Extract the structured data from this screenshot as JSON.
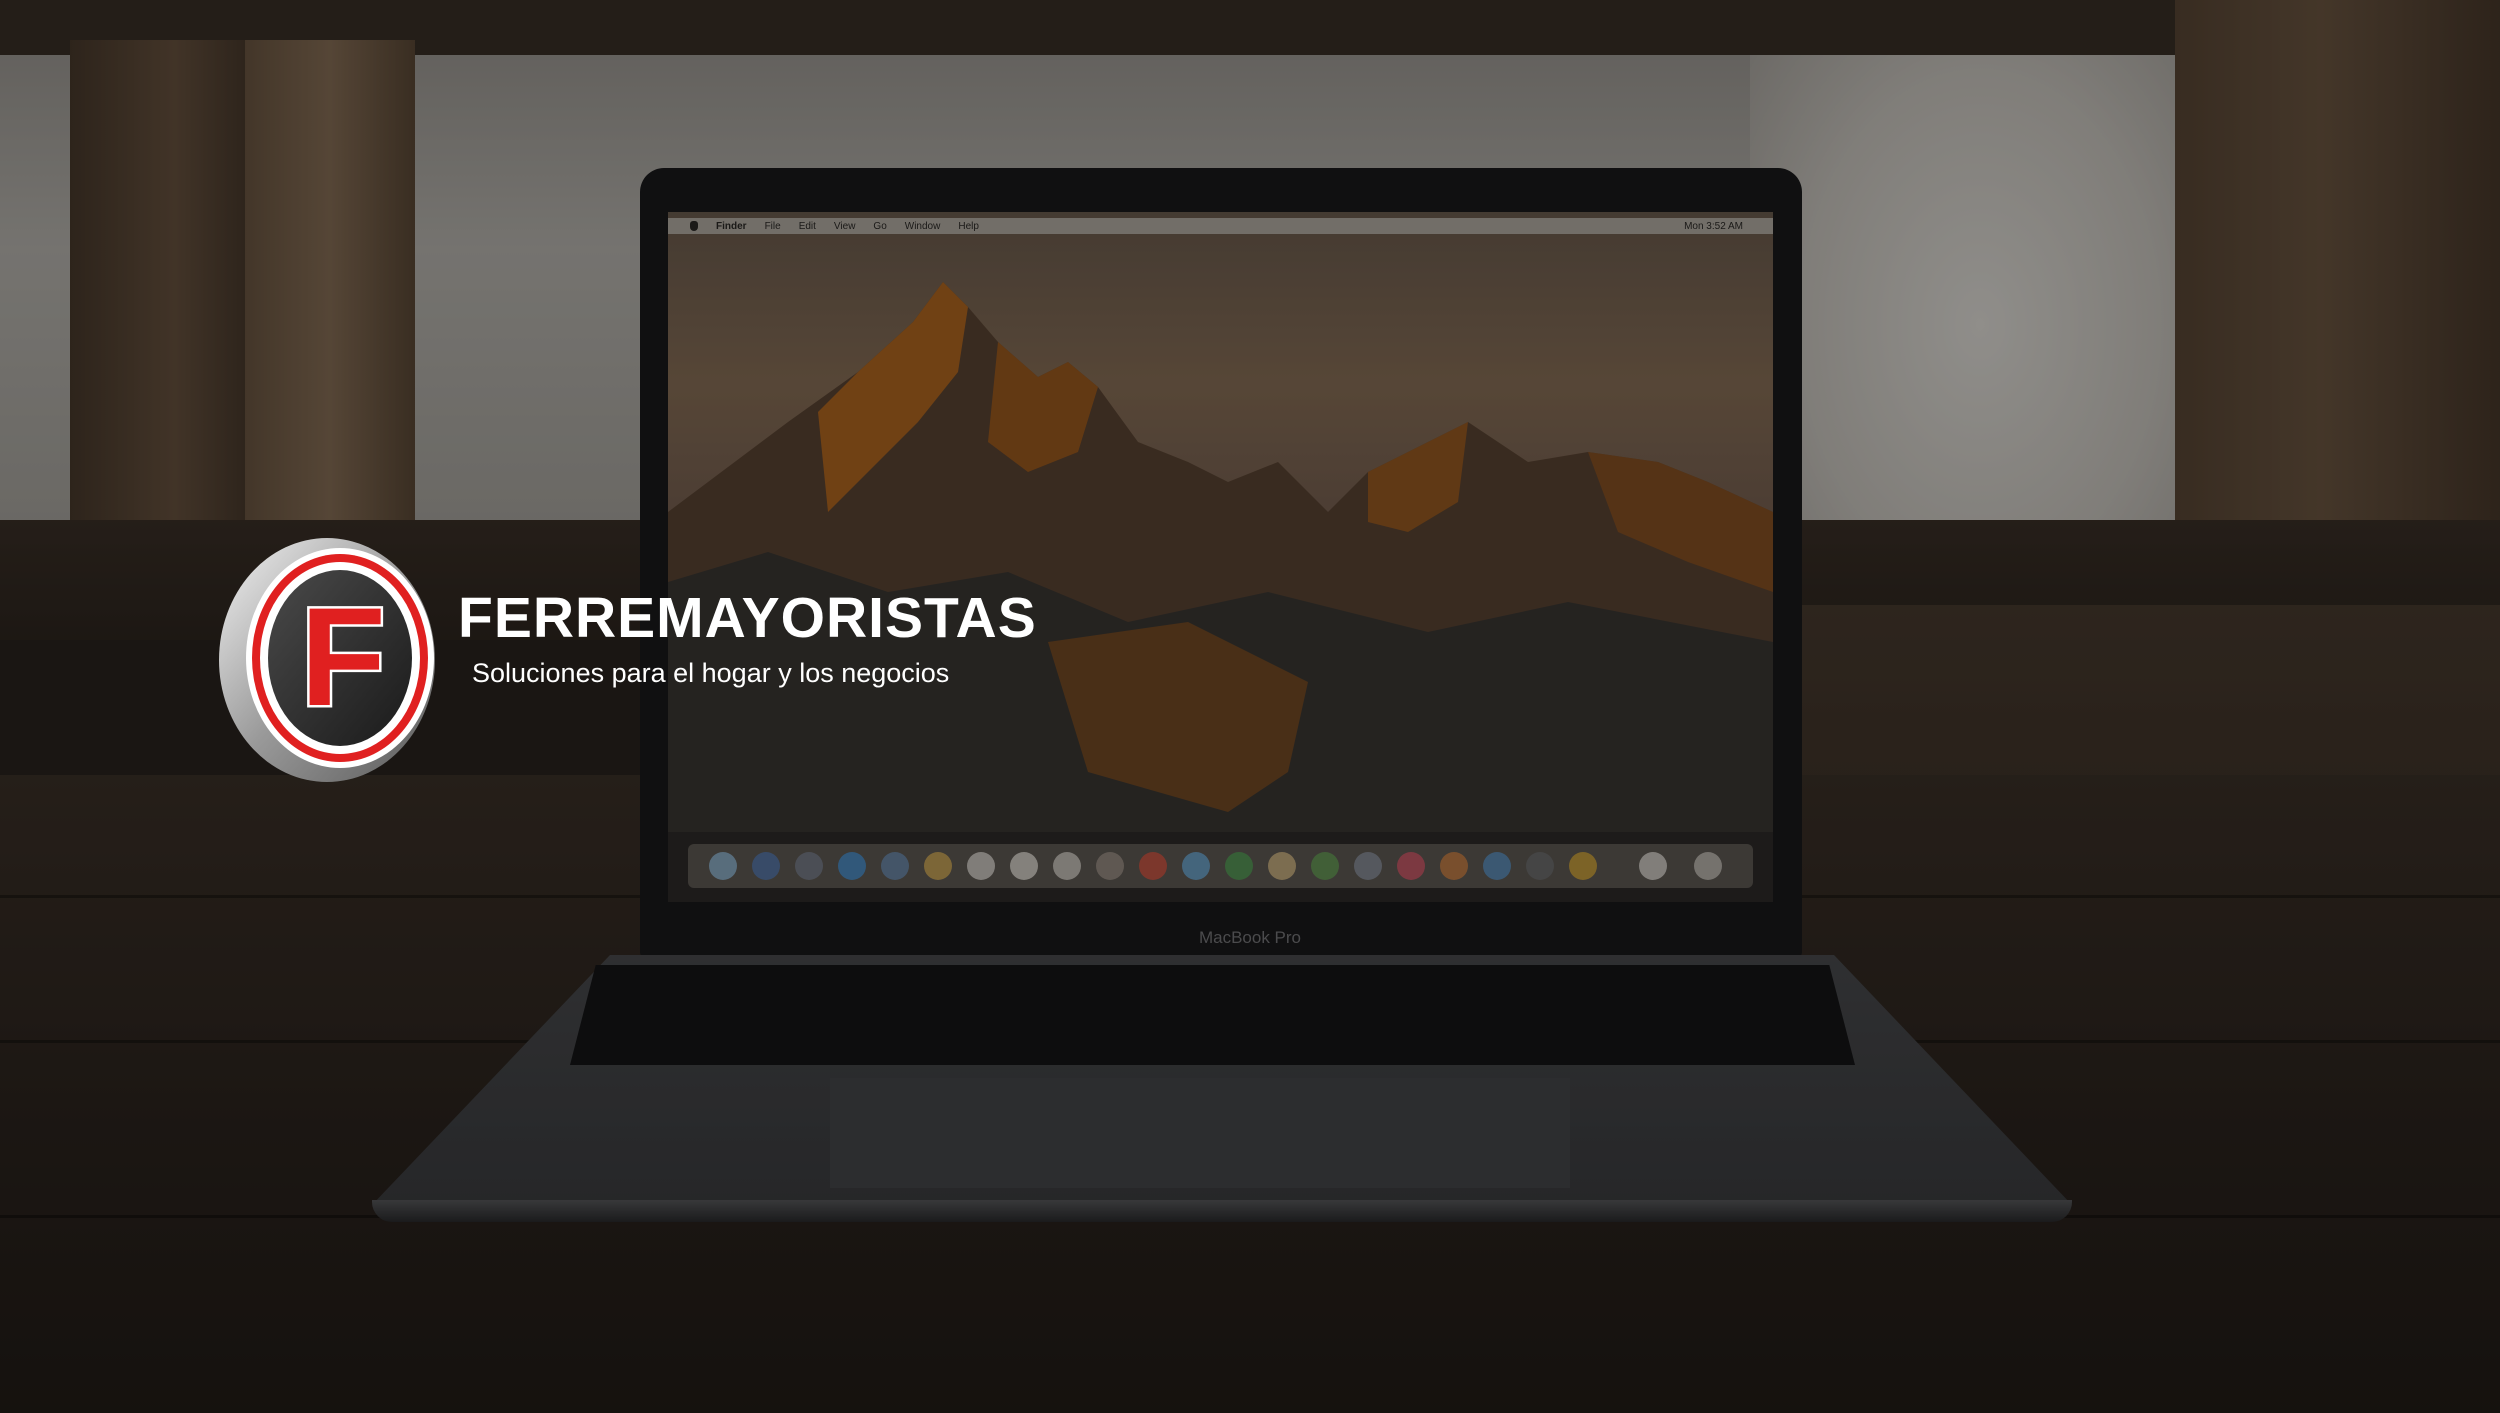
{
  "logo": {
    "initial": "F",
    "brand": "FERREMAYORISTAS",
    "tagline": "Soluciones para el hogar y los negocios"
  },
  "laptop": {
    "model_label": "MacBook Pro",
    "menu_bar": {
      "app_name": "Finder",
      "items": [
        "File",
        "Edit",
        "View",
        "Go",
        "Window",
        "Help"
      ],
      "status_text": "Mon 3:52 AM"
    }
  },
  "colors": {
    "logo_red": "#e02020",
    "logo_silver": "#b8b8b8",
    "text_white": "#ffffff"
  }
}
